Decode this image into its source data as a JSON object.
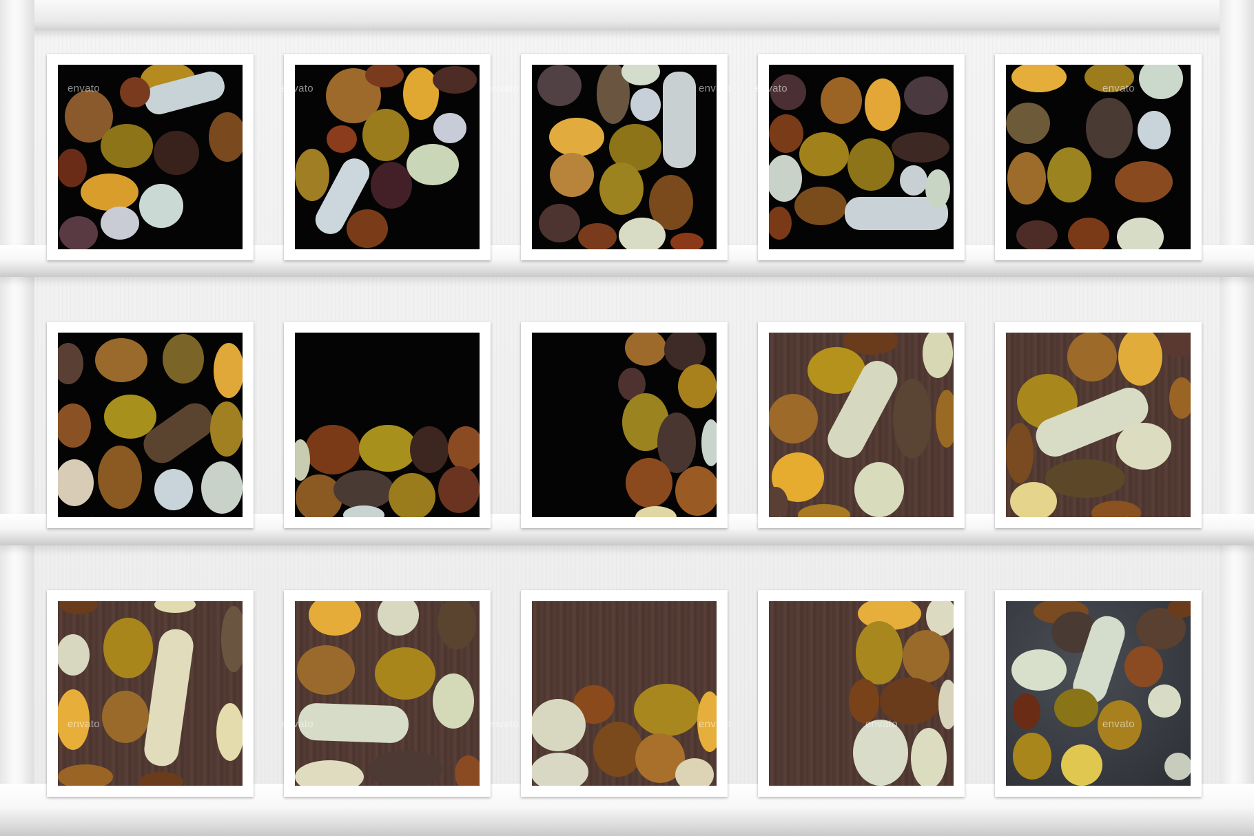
{
  "scene": {
    "layout": "stone photo grid on white wooden shelves",
    "rows": 3,
    "columns": 5,
    "colors": {
      "shelf": "#f1f1f1",
      "frame": "#ffffff",
      "black_bg": "#050404",
      "wood_bg": "#503a33",
      "slate_bg": "#3a3d43"
    }
  },
  "watermark_text": "envato",
  "photos": [
    {
      "background": "black"
    },
    {
      "background": "black"
    },
    {
      "background": "black"
    },
    {
      "background": "black"
    },
    {
      "background": "black"
    },
    {
      "background": "black"
    },
    {
      "background": "black"
    },
    {
      "background": "black"
    },
    {
      "background": "wood"
    },
    {
      "background": "wood"
    },
    {
      "background": "wood"
    },
    {
      "background": "wood"
    },
    {
      "background": "wood"
    },
    {
      "background": "wood"
    },
    {
      "background": "slate"
    }
  ]
}
